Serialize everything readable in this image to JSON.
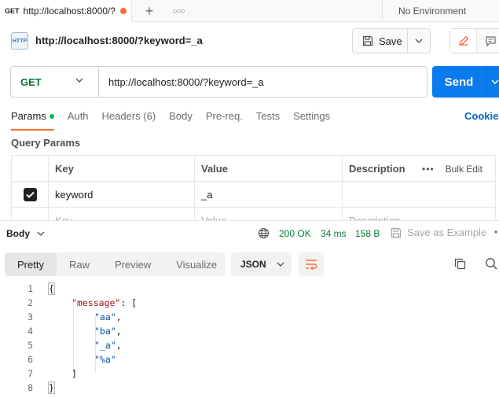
{
  "tab": {
    "method": "GET",
    "title": "http://localhost:8000/?",
    "add_icon": "plus-icon",
    "more_icon": "ellipsis-icon"
  },
  "environment": "No Environment",
  "request": {
    "icon_text": "HTTP",
    "title": "http://localhost:8000/?keyword=_a",
    "save_label": "Save",
    "method": "GET",
    "url": "http://localhost:8000/?keyword=_a",
    "send_label": "Send"
  },
  "request_tabs": [
    {
      "label": "Params"
    },
    {
      "label": "Auth"
    },
    {
      "label": "Headers (6)"
    },
    {
      "label": "Body"
    },
    {
      "label": "Pre-req."
    },
    {
      "label": "Tests"
    },
    {
      "label": "Settings"
    }
  ],
  "cookies_label": "Cookies",
  "query_params": {
    "title": "Query Params",
    "headers": {
      "key": "Key",
      "value": "Value",
      "description": "Description",
      "bulk_edit": "Bulk Edit"
    },
    "rows": [
      {
        "checked": true,
        "key": "keyword",
        "value": "_a",
        "description": ""
      }
    ],
    "placeholder": {
      "key": "Key",
      "value": "Value",
      "description": "Description"
    }
  },
  "response": {
    "body_label": "Body",
    "status": "200 OK",
    "time": "34 ms",
    "size": "158 B",
    "save_example": "Save as Example",
    "view_tabs": [
      "Pretty",
      "Raw",
      "Preview",
      "Visualize"
    ],
    "format": "JSON",
    "lines": [
      {
        "n": "1",
        "text": "{"
      },
      {
        "n": "2",
        "key": "\"message\"",
        "rest": ": ["
      },
      {
        "n": "3",
        "str": "\"aa\"",
        "rest": ","
      },
      {
        "n": "4",
        "str": "\"ba\"",
        "rest": ","
      },
      {
        "n": "5",
        "str": "\"_a\"",
        "rest": ","
      },
      {
        "n": "6",
        "str": "\"%a\"",
        "rest": ""
      },
      {
        "n": "7",
        "text": "]"
      },
      {
        "n": "8",
        "text": "}"
      }
    ]
  },
  "colors": {
    "accent": "#ff6c37",
    "send": "#097bed",
    "method": "#0b7a3f",
    "status_ok": "#007f31",
    "link": "#0265d2"
  }
}
